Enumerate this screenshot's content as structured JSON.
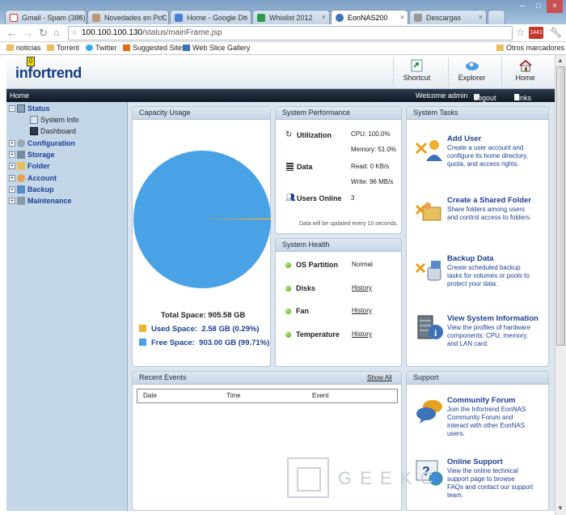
{
  "browser": {
    "tabs": [
      {
        "title": "Gmail - Spam (386)",
        "color": "#c6372c"
      },
      {
        "title": "Novedades en PcC",
        "color": "#8a6a4a"
      },
      {
        "title": "Home - Google Do",
        "color": "#4c7fd1"
      },
      {
        "title": "Whislist 2012",
        "color": "#2e9a48"
      },
      {
        "title": "EonNAS200",
        "color": "#3c72b8"
      },
      {
        "title": "Descargas",
        "color": "#777777"
      }
    ],
    "url_host": "100.100.100.130",
    "url_path": "/status/mainFrame.jsp",
    "bookmarks": [
      "noticias",
      "Torrent",
      "Twitter",
      "Suggested Sites",
      "Web Slice Gallery"
    ],
    "other_bookmarks": "Otros marcadores",
    "ext_badge": "1441"
  },
  "header": {
    "logo": "infortrend",
    "buttons": [
      "Shortcut",
      "Explorer",
      "Home"
    ]
  },
  "menu": {
    "home": "Home",
    "welcome": "Welcome admin",
    "logout": "Logout",
    "links": "Links"
  },
  "sidebar": {
    "items": [
      {
        "label": "Status",
        "expanded": true,
        "children": [
          "System Info",
          "Dashboard"
        ]
      },
      {
        "label": "Configuration"
      },
      {
        "label": "Storage"
      },
      {
        "label": "Folder"
      },
      {
        "label": "Account"
      },
      {
        "label": "Backup"
      },
      {
        "label": "Maintenance"
      }
    ]
  },
  "capacity": {
    "title": "Capacity Usage",
    "total_label": "Total Space:",
    "total_value": "905.58 GB",
    "used_label": "Used Space:",
    "used_value": "2.58 GB (0.29%)",
    "free_label": "Free Space:",
    "free_value": "903.00 GB (99.71%)",
    "used_fraction": 0.0029,
    "used_color": "#f0b030",
    "free_color": "#4aa2e6"
  },
  "performance": {
    "title": "System Performance",
    "utilization_label": "Utilization",
    "cpu": "CPU: 100.0%",
    "memory": "Memory: 51.0%",
    "data_label": "Data",
    "read": "Read: 0 KB/s",
    "write": "Write: 96 MB/s",
    "users_label": "Users Online",
    "users_value": "3",
    "note": "Data will be updated every 10 seconds."
  },
  "health": {
    "title": "System Health",
    "rows": [
      {
        "label": "OS Partition",
        "value": "Normal",
        "is_link": false
      },
      {
        "label": "Disks",
        "value": "History",
        "is_link": true
      },
      {
        "label": "Fan",
        "value": "History",
        "is_link": true
      },
      {
        "label": "Temperature",
        "value": "History",
        "is_link": true
      }
    ]
  },
  "tasks": {
    "title": "System Tasks",
    "items": [
      {
        "title": "Add User",
        "desc": [
          "Create a user account and",
          "configure its home directory,",
          "quota, and access rights."
        ]
      },
      {
        "title": "Create a Shared Folder",
        "desc": [
          "Share folders among users",
          "and control access to folders."
        ]
      },
      {
        "title": "Backup Data",
        "desc": [
          "Create scheduled backup",
          "tasks for volumes or pools to",
          "protect your data."
        ]
      },
      {
        "title": "View System Information",
        "desc": [
          "View the profiles of hardware",
          "components: CPU, memory,",
          "and LAN card."
        ]
      }
    ]
  },
  "events": {
    "title": "Recent Events",
    "show_all": "Show All",
    "columns": [
      "Date",
      "Time",
      "Event"
    ]
  },
  "support": {
    "title": "Support",
    "items": [
      {
        "title": "Community Forum",
        "desc": [
          "Join the Infortrend EonNAS",
          "Community Forum and",
          "interact with other EonNAS",
          "users."
        ]
      },
      {
        "title": "Online Support",
        "desc": [
          "View the online technical",
          "support page to browse",
          "FAQs and contact our support",
          "team."
        ]
      }
    ]
  },
  "watermark": "G E E K   C"
}
